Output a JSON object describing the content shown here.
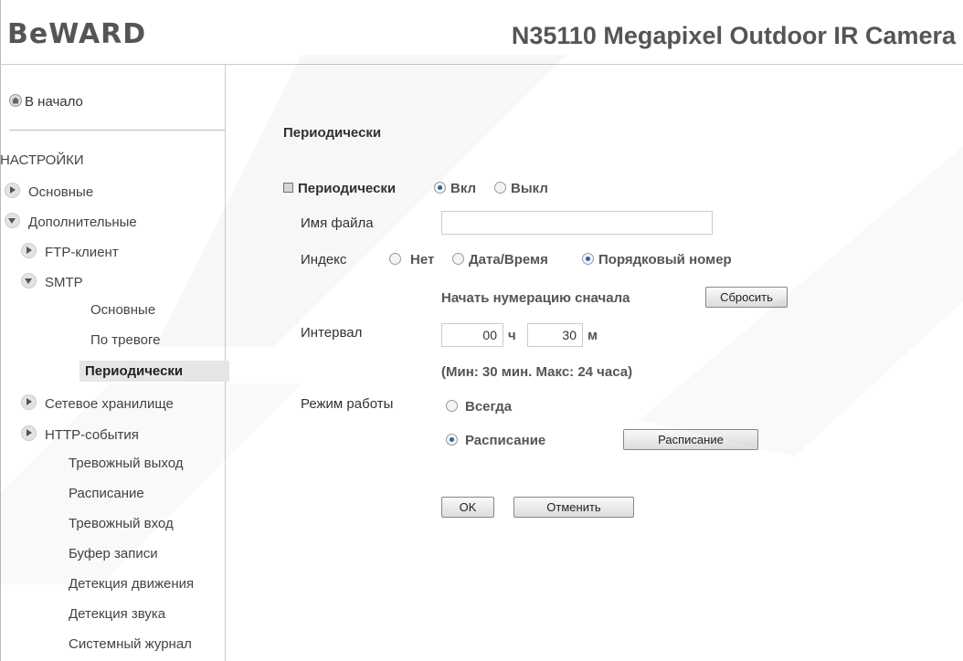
{
  "header": {
    "logo": "BeWARD",
    "product_title": "N35110 Megapixel Outdoor IR Camera"
  },
  "sidebar": {
    "home_label": "В начало",
    "settings_heading": "НАСТРОЙКИ",
    "items": {
      "basic": "Основные",
      "advanced": "Дополнительные",
      "ftp": "FTP-клиент",
      "smtp": "SMTP",
      "smtp_basic": "Основные",
      "smtp_alarm": "По тревоге",
      "smtp_periodic": "Периодически",
      "storage": "Сетевое хранилище",
      "http_events": "HTTP-события",
      "alarm_out": "Тревожный выход",
      "schedule": "Расписание",
      "alarm_in": "Тревожный вход",
      "record_buffer": "Буфер записи",
      "motion": "Детекция движения",
      "sound": "Детекция звука",
      "syslog": "Системный журнал"
    }
  },
  "form": {
    "title": "Периодически",
    "periodic_label": "Периодически",
    "on_label": "Вкл",
    "off_label": "Выкл",
    "filename_label": "Имя файла",
    "filename_value": "",
    "index_label": "Индекс",
    "index_none": "Нет",
    "index_datetime": "Дата/Время",
    "index_sequence": "Порядковый номер",
    "reset_numbering_label": "Начать нумерацию сначала",
    "reset_button": "Сбросить",
    "interval_label": "Интервал",
    "interval_hours": "00",
    "hours_unit": "ч",
    "interval_minutes": "30",
    "minutes_unit": "м",
    "interval_hint": "(Мин: 30 мин. Макс: 24 часа)",
    "mode_label": "Режим работы",
    "mode_always": "Всегда",
    "mode_schedule": "Расписание",
    "schedule_button": "Расписание",
    "ok_button": "OK",
    "cancel_button": "Отменить"
  }
}
